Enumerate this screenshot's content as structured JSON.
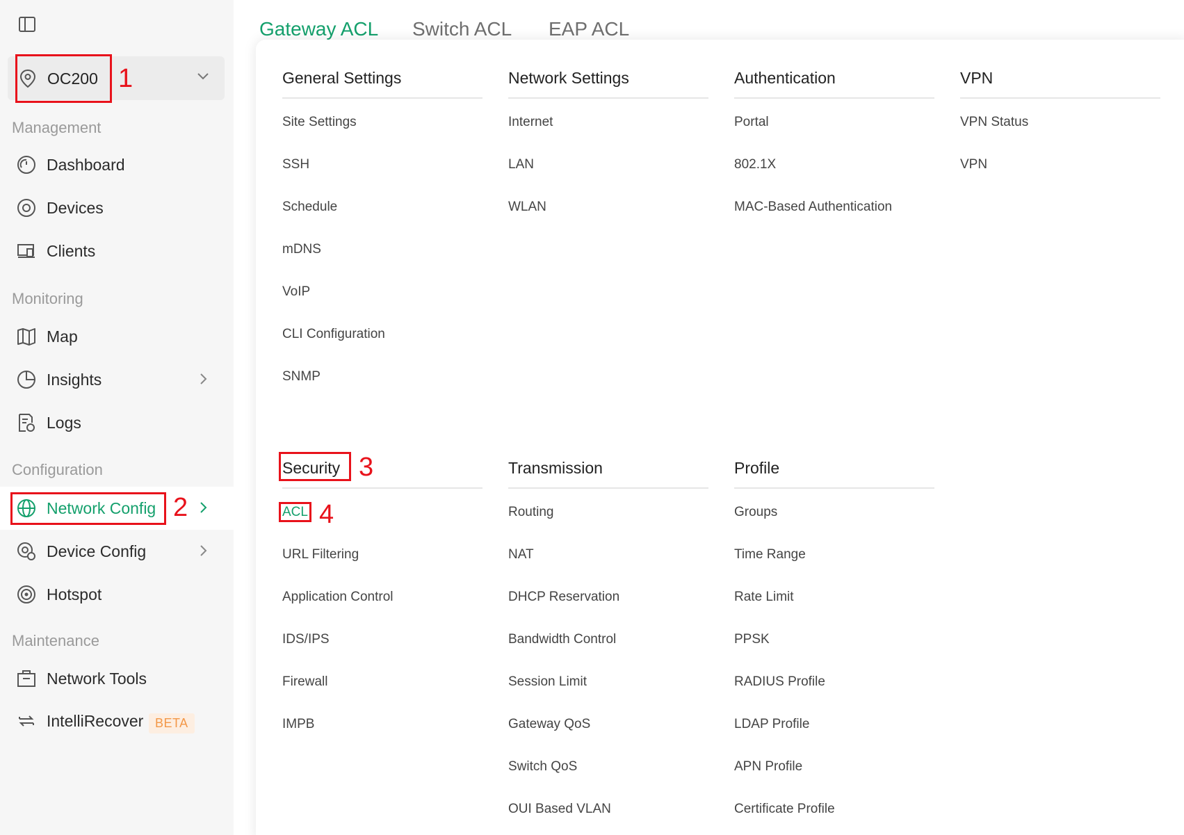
{
  "sidebar": {
    "site": {
      "name": "OC200"
    },
    "sections": {
      "management": "Management",
      "monitoring": "Monitoring",
      "configuration": "Configuration",
      "maintenance": "Maintenance"
    },
    "items": {
      "dashboard": "Dashboard",
      "devices": "Devices",
      "clients": "Clients",
      "map": "Map",
      "insights": "Insights",
      "logs": "Logs",
      "network_config": "Network Config",
      "device_config": "Device Config",
      "hotspot": "Hotspot",
      "network_tools": "Network Tools",
      "intellirecover": "IntelliRecover",
      "beta_badge": "BETA"
    },
    "accent_color": "#14a06c"
  },
  "tabs": [
    "Gateway ACL",
    "Switch ACL",
    "EAP ACL"
  ],
  "menu": {
    "general_settings": {
      "title": "General Settings",
      "items": [
        "Site Settings",
        "SSH",
        "Schedule",
        "mDNS",
        "VoIP",
        "CLI Configuration",
        "SNMP"
      ]
    },
    "network_settings": {
      "title": "Network Settings",
      "items": [
        "Internet",
        "LAN",
        "WLAN"
      ]
    },
    "authentication": {
      "title": "Authentication",
      "items": [
        "Portal",
        "802.1X",
        "MAC-Based Authentication"
      ]
    },
    "vpn": {
      "title": "VPN",
      "items": [
        "VPN Status",
        "VPN"
      ]
    },
    "security": {
      "title": "Security",
      "items": [
        "ACL",
        "URL Filtering",
        "Application Control",
        "IDS/IPS",
        "Firewall",
        "IMPB"
      ]
    },
    "transmission": {
      "title": "Transmission",
      "items": [
        "Routing",
        "NAT",
        "DHCP Reservation",
        "Bandwidth Control",
        "Session Limit",
        "Gateway QoS",
        "Switch QoS",
        "OUI Based VLAN"
      ]
    },
    "profile": {
      "title": "Profile",
      "items": [
        "Groups",
        "Time Range",
        "Rate Limit",
        "PPSK",
        "RADIUS Profile",
        "LDAP Profile",
        "APN Profile",
        "Certificate Profile"
      ]
    }
  },
  "annotations": [
    "1",
    "2",
    "3",
    "4"
  ],
  "annotation_color": "#e8121b"
}
